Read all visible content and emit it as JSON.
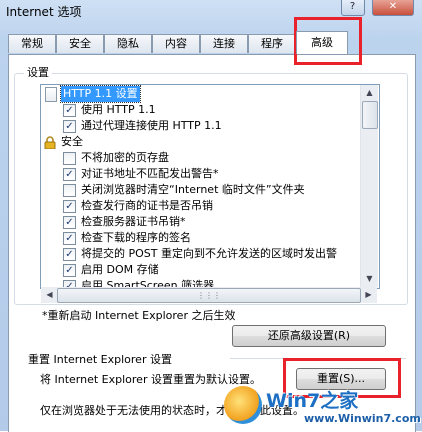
{
  "window": {
    "title": "Internet 选项",
    "help_label": "?",
    "close_label": "✕"
  },
  "tabs": [
    {
      "label": "常规"
    },
    {
      "label": "安全"
    },
    {
      "label": "隐私"
    },
    {
      "label": "内容"
    },
    {
      "label": "连接"
    },
    {
      "label": "程序"
    },
    {
      "label": "高级",
      "active": true
    }
  ],
  "settings": {
    "group_label": "设置",
    "items": [
      {
        "kind": "header",
        "icon": "page-icon",
        "label": "HTTP 1.1 设置",
        "selected": true
      },
      {
        "kind": "checkbox",
        "checked": true,
        "label": "使用 HTTP 1.1"
      },
      {
        "kind": "checkbox",
        "checked": true,
        "label": "通过代理连接使用 HTTP 1.1"
      },
      {
        "kind": "header",
        "icon": "lock-icon",
        "label": "安全"
      },
      {
        "kind": "checkbox",
        "checked": false,
        "label": "不将加密的页存盘"
      },
      {
        "kind": "checkbox",
        "checked": true,
        "label": "对证书地址不匹配发出警告*"
      },
      {
        "kind": "checkbox",
        "checked": false,
        "label": "关闭浏览器时清空“Internet 临时文件”文件夹"
      },
      {
        "kind": "checkbox",
        "checked": true,
        "label": "检查发行商的证书是否吊销"
      },
      {
        "kind": "checkbox",
        "checked": true,
        "label": "检查服务器证书吊销*"
      },
      {
        "kind": "checkbox",
        "checked": true,
        "label": "检查下载的程序的签名"
      },
      {
        "kind": "checkbox",
        "checked": true,
        "label": "将提交的 POST 重定向到不允许发送的区域时发出警"
      },
      {
        "kind": "checkbox",
        "checked": true,
        "label": "启用 DOM 存储"
      },
      {
        "kind": "checkbox",
        "checked": true,
        "label": "启用 SmartScreen 筛选器"
      }
    ],
    "restart_note": "*重新启动 Internet Explorer 之后生效",
    "restore_button": "还原高级设置(R)"
  },
  "reset": {
    "title": "重置 Internet Explorer 设置",
    "description": "将 Internet Explorer 设置重置为默认设置。",
    "button": "重置(S)...",
    "footer": "仅在浏览器处于无法使用的状态时，才应使用此设置。"
  },
  "watermark": {
    "title": "Win7之家",
    "url": "www.Winwin7.com"
  },
  "colors": {
    "highlight": "#e8212b",
    "selection": "#3399ff"
  }
}
